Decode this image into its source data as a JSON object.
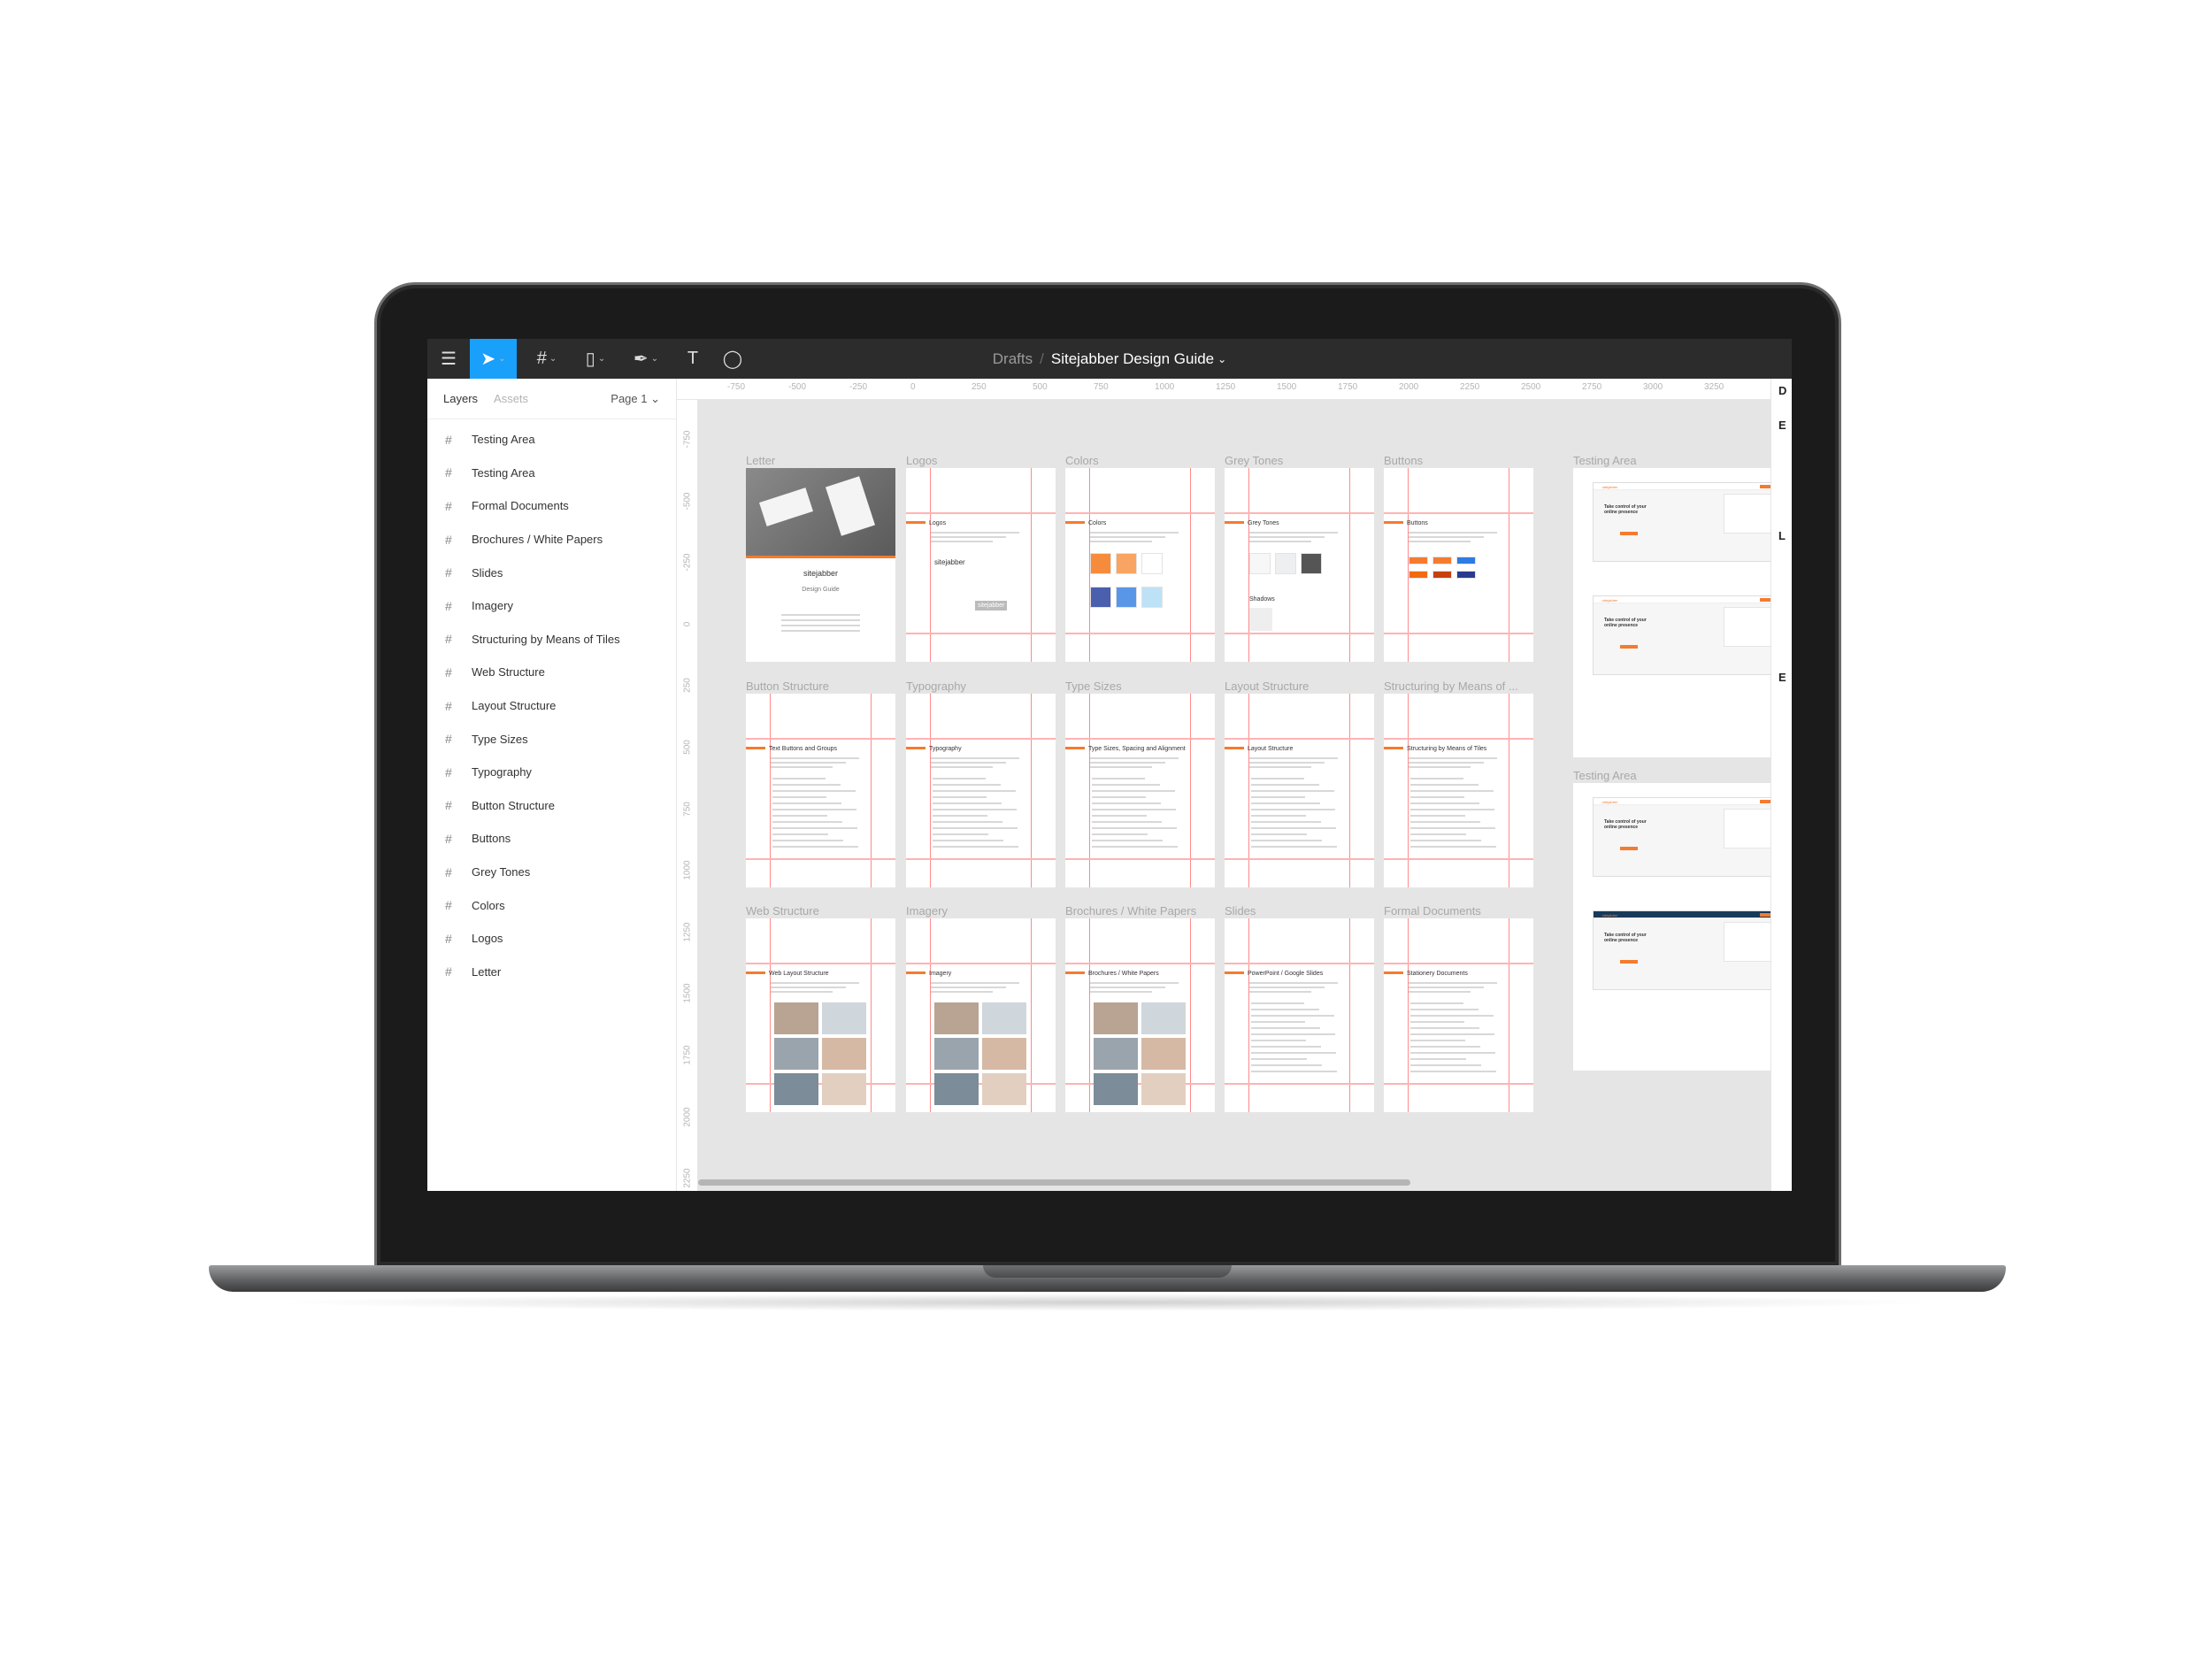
{
  "toolbar": {
    "tools": [
      {
        "name": "menu-icon",
        "glyph": "☰",
        "chevron": false,
        "active": false
      },
      {
        "name": "move-tool-icon",
        "glyph": "➤",
        "chevron": true,
        "active": true
      },
      {
        "name": "frame-tool-icon",
        "glyph": "#",
        "chevron": true,
        "active": false
      },
      {
        "name": "rectangle-tool-icon",
        "glyph": "▯",
        "chevron": true,
        "active": false
      },
      {
        "name": "pen-tool-icon",
        "glyph": "✒",
        "chevron": true,
        "active": false
      },
      {
        "name": "text-tool-icon",
        "glyph": "T",
        "chevron": false,
        "active": false
      },
      {
        "name": "comment-tool-icon",
        "glyph": "◯",
        "chevron": false,
        "active": false
      }
    ],
    "breadcrumb": {
      "parent": "Drafts",
      "separator": "/",
      "file": "Sitejabber Design Guide",
      "chevron": "⌄"
    },
    "accent": "#18a0fb"
  },
  "sidebar": {
    "tabs": [
      "Layers",
      "Assets"
    ],
    "page": "Page 1 ⌄",
    "layers": [
      "Testing Area",
      "Testing Area",
      "Formal Documents",
      "Brochures / White Papers",
      "Slides",
      "Imagery",
      "Structuring by Means of Tiles",
      "Web Structure",
      "Layout Structure",
      "Type Sizes",
      "Typography",
      "Button Structure",
      "Buttons",
      "Grey Tones",
      "Colors",
      "Logos",
      "Letter"
    ]
  },
  "rulers": {
    "horizontal": [
      "-750",
      "-500",
      "-250",
      "0",
      "250",
      "500",
      "750",
      "1000",
      "1250",
      "1500",
      "1750",
      "2000",
      "2250",
      "2500",
      "2750",
      "3000",
      "3250"
    ],
    "vertical": [
      "-750",
      "-500",
      "-250",
      "0",
      "250",
      "500",
      "750",
      "1000",
      "1250",
      "1500",
      "1750",
      "2000",
      "2250"
    ]
  },
  "right_panel": {
    "letters": [
      "D",
      "E",
      "L",
      "E"
    ]
  },
  "canvas": {
    "guide_color": "#ff8a8a",
    "brand_orange": "#f47b30",
    "frames": [
      {
        "label": "Letter",
        "heading": "",
        "kind": "letter",
        "brand": "sitejabber",
        "subtitle": "Design Guide"
      },
      {
        "label": "Logos",
        "heading": "Logos",
        "kind": "logos",
        "brand": "sitejabber"
      },
      {
        "label": "Colors",
        "heading": "Colors",
        "kind": "colors",
        "swatches": [
          "#f68b3c",
          "#f9a462",
          "#ffffff",
          "#4a5fae",
          "#5a96e8",
          "#bde2f6"
        ]
      },
      {
        "label": "Grey Tones",
        "heading": "Grey Tones",
        "kind": "grey",
        "swatches": [
          "#f7f7f7",
          "#eeeff1",
          "#555555"
        ],
        "subheading": "Shadows"
      },
      {
        "label": "Buttons",
        "heading": "Buttons",
        "kind": "buttons",
        "swatches": [
          "#f47b30",
          "#f47b30",
          "#2d7be5",
          "#f26a10",
          "#c9400f",
          "#2a3b8f"
        ]
      },
      {
        "label": "Button Structure",
        "heading": "Text Buttons and Groups",
        "kind": "text"
      },
      {
        "label": "Typography",
        "heading": "Typography",
        "kind": "text"
      },
      {
        "label": "Type Sizes",
        "heading": "Type Sizes, Spacing and Alignment",
        "kind": "text"
      },
      {
        "label": "Layout Structure",
        "heading": "Layout Structure",
        "kind": "text"
      },
      {
        "label": "Structuring by Means of ...",
        "heading": "Structuring by Means of Tiles",
        "kind": "text"
      },
      {
        "label": "Web Structure",
        "heading": "Web Layout Structure",
        "kind": "images"
      },
      {
        "label": "Imagery",
        "heading": "Imagery",
        "kind": "images"
      },
      {
        "label": "Brochures / White Papers",
        "heading": "Brochures / White Papers",
        "kind": "images"
      },
      {
        "label": "Slides",
        "heading": "PowerPoint / Google Slides",
        "kind": "text"
      },
      {
        "label": "Formal Documents",
        "heading": "Stationery Documents",
        "kind": "text"
      }
    ],
    "testing_areas": [
      {
        "label": "Testing Area",
        "mockups": [
          {
            "title": "Take control of your online presence",
            "dark": false
          },
          {
            "title": "Take control of your online presence",
            "dark": false
          }
        ]
      },
      {
        "label": "Testing Area",
        "mockups": [
          {
            "title": "Take control of your online presence",
            "dark": false
          },
          {
            "title": "Take control of your online presence",
            "dark": true
          }
        ]
      }
    ],
    "mock_brand": "sitejabber"
  }
}
